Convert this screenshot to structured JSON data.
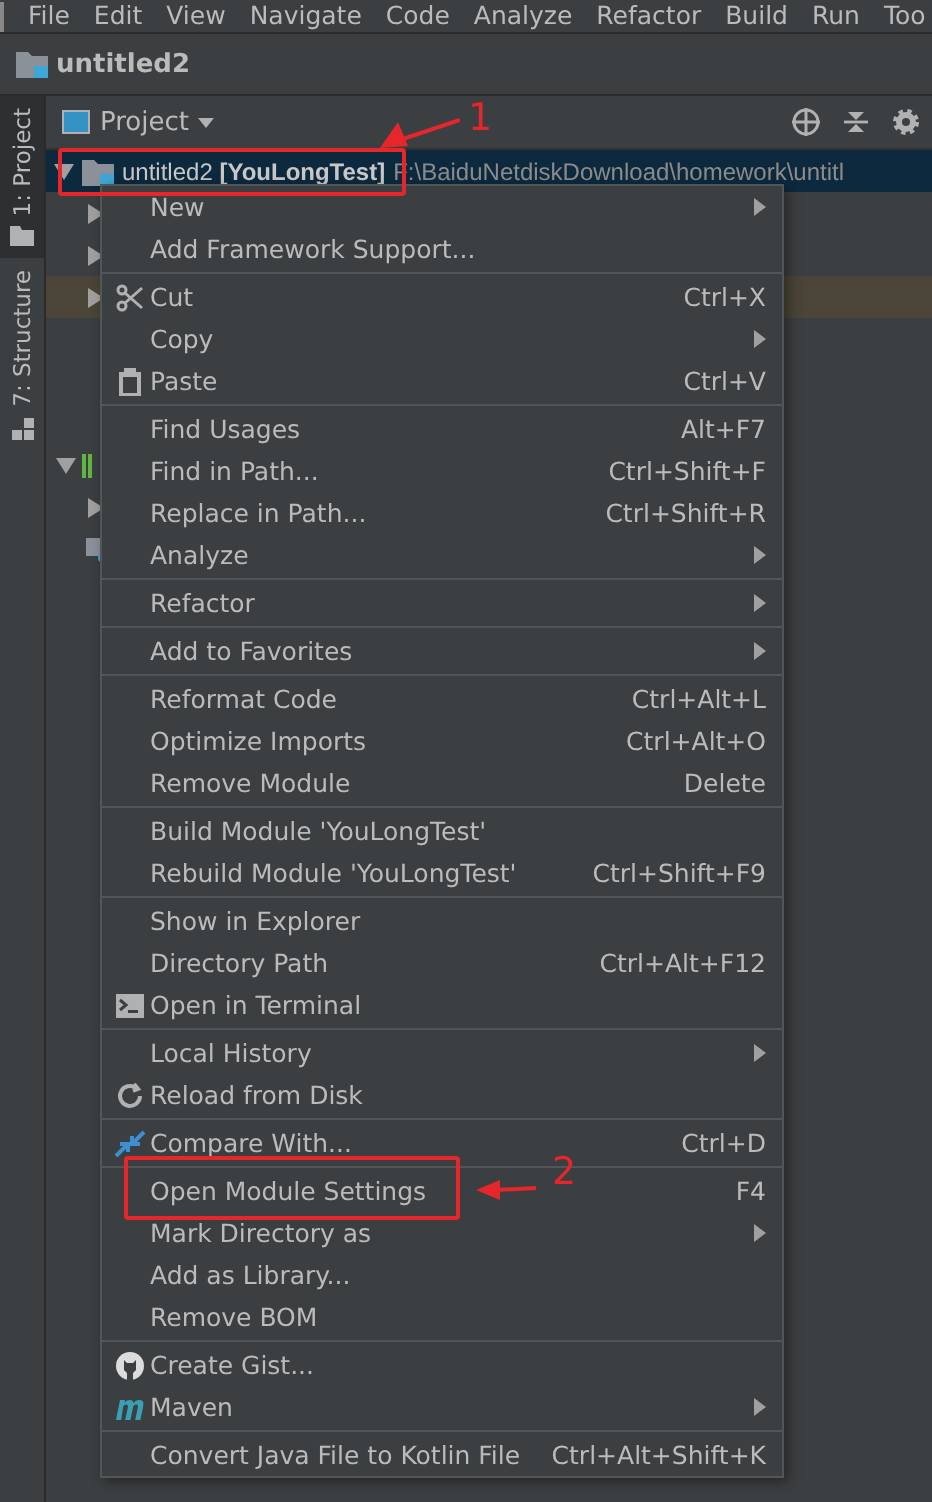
{
  "menubar": [
    "File",
    "Edit",
    "View",
    "Navigate",
    "Code",
    "Analyze",
    "Refactor",
    "Build",
    "Run",
    "Too"
  ],
  "project_title": "untitled2",
  "side_tabs": [
    {
      "label": "1: Project",
      "selected": true
    },
    {
      "label": "7: Structure",
      "selected": false
    }
  ],
  "view_selector": "Project",
  "tree": {
    "root": {
      "name": "untitled2",
      "module": "[YouLongTest]",
      "path": "F:\\BaiduNetdiskDownload\\homework\\untitl",
      "expanded": true,
      "selected": true
    },
    "rows": [
      {
        "kind": "folder",
        "expanded": false,
        "highlighted": false
      },
      {
        "kind": "folder",
        "expanded": false,
        "highlighted": false
      },
      {
        "kind": "folder",
        "expanded": false,
        "highlighted": true
      },
      {
        "kind": "library",
        "expanded": true,
        "highlighted": false
      },
      {
        "kind": "folder",
        "expanded": false,
        "highlighted": false
      },
      {
        "kind": "console",
        "highlighted": false
      }
    ]
  },
  "context_menu": {
    "groups": [
      [
        {
          "label": "New",
          "submenu": true
        },
        {
          "label": "Add Framework Support...",
          "submenu": false
        }
      ],
      [
        {
          "label": "Cut",
          "shortcut": "Ctrl+X",
          "kind": "scissors",
          "submenu": false
        },
        {
          "label": "Copy",
          "submenu": true
        },
        {
          "label": "Paste",
          "shortcut": "Ctrl+V",
          "kind": "clipboard",
          "submenu": false
        }
      ],
      [
        {
          "label": "Find Usages",
          "shortcut": "Alt+F7",
          "submenu": false
        },
        {
          "label": "Find in Path...",
          "shortcut": "Ctrl+Shift+F",
          "submenu": false
        },
        {
          "label": "Replace in Path...",
          "shortcut": "Ctrl+Shift+R",
          "submenu": false
        },
        {
          "label": "Analyze",
          "submenu": true
        }
      ],
      [
        {
          "label": "Refactor",
          "submenu": true
        }
      ],
      [
        {
          "label": "Add to Favorites",
          "submenu": true
        }
      ],
      [
        {
          "label": "Reformat Code",
          "shortcut": "Ctrl+Alt+L",
          "submenu": false
        },
        {
          "label": "Optimize Imports",
          "shortcut": "Ctrl+Alt+O",
          "submenu": false
        },
        {
          "label": "Remove Module",
          "shortcut": "Delete",
          "submenu": false
        }
      ],
      [
        {
          "label": "Build Module 'YouLongTest'",
          "submenu": false
        },
        {
          "label": "Rebuild Module 'YouLongTest'",
          "shortcut": "Ctrl+Shift+F9",
          "submenu": false
        }
      ],
      [
        {
          "label": "Show in Explorer",
          "submenu": false
        },
        {
          "label": "Directory Path",
          "shortcut": "Ctrl+Alt+F12",
          "submenu": false
        },
        {
          "label": "Open in Terminal",
          "kind": "terminal",
          "submenu": false
        }
      ],
      [
        {
          "label": "Local History",
          "submenu": true
        },
        {
          "label": "Reload from Disk",
          "kind": "reload",
          "submenu": false
        }
      ],
      [
        {
          "label": "Compare With...",
          "shortcut": "Ctrl+D",
          "kind": "compare",
          "submenu": false
        }
      ],
      [
        {
          "label": "Open Module Settings",
          "shortcut": "F4",
          "submenu": false
        },
        {
          "label": "Mark Directory as",
          "submenu": true
        },
        {
          "label": "Add as Library...",
          "submenu": false
        },
        {
          "label": "Remove BOM",
          "submenu": false
        }
      ],
      [
        {
          "label": "Create Gist...",
          "kind": "github",
          "submenu": false
        },
        {
          "label": "Maven",
          "kind": "maven",
          "submenu": true
        }
      ],
      [
        {
          "label": "Convert Java File to Kotlin File",
          "shortcut": "Ctrl+Alt+Shift+K",
          "submenu": false
        }
      ]
    ]
  },
  "annotations": [
    {
      "label": "1"
    },
    {
      "label": "2"
    }
  ]
}
